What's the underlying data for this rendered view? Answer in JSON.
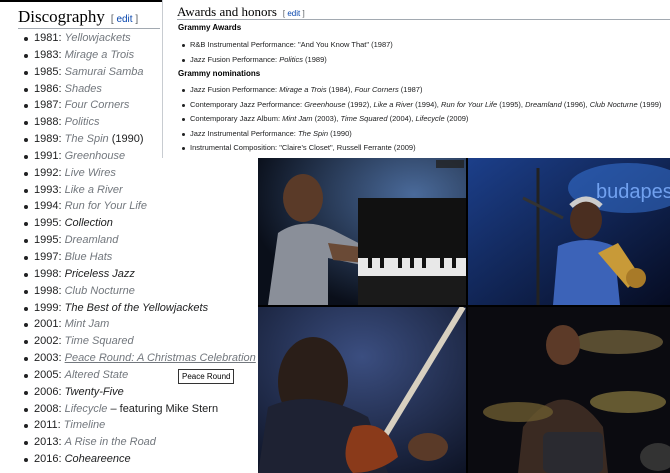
{
  "discography": {
    "title": "Discography",
    "edit_label": "edit",
    "albums": [
      {
        "year": "1981",
        "title": "Yellowjackets",
        "suffix": "",
        "style": "gray"
      },
      {
        "year": "1983",
        "title": "Mirage a Trois",
        "suffix": "",
        "style": "gray"
      },
      {
        "year": "1985",
        "title": "Samurai Samba",
        "suffix": "",
        "style": "gray"
      },
      {
        "year": "1986",
        "title": "Shades",
        "suffix": "",
        "style": "gray"
      },
      {
        "year": "1987",
        "title": "Four Corners",
        "suffix": "",
        "style": "gray"
      },
      {
        "year": "1988",
        "title": "Politics",
        "suffix": "",
        "style": "gray"
      },
      {
        "year": "1989",
        "title": "The Spin",
        "suffix": " (1990)",
        "style": "gray"
      },
      {
        "year": "1991",
        "title": "Greenhouse",
        "suffix": "",
        "style": "gray"
      },
      {
        "year": "1992",
        "title": "Live Wires",
        "suffix": "",
        "style": "gray"
      },
      {
        "year": "1993",
        "title": "Like a River",
        "suffix": "",
        "style": "gray"
      },
      {
        "year": "1994",
        "title": "Run for Your Life",
        "suffix": "",
        "style": "gray"
      },
      {
        "year": "1995",
        "title": "Collection",
        "suffix": "",
        "style": "dark"
      },
      {
        "year": "1995",
        "title": "Dreamland",
        "suffix": "",
        "style": "gray"
      },
      {
        "year": "1997",
        "title": "Blue Hats",
        "suffix": "",
        "style": "gray"
      },
      {
        "year": "1998",
        "title": "Priceless Jazz",
        "suffix": "",
        "style": "dark"
      },
      {
        "year": "1998",
        "title": "Club Nocturne",
        "suffix": "",
        "style": "gray"
      },
      {
        "year": "1999",
        "title": "The Best of the Yellowjackets",
        "suffix": "",
        "style": "dark"
      },
      {
        "year": "2001",
        "title": "Mint Jam",
        "suffix": "",
        "style": "gray"
      },
      {
        "year": "2002",
        "title": "Time Squared",
        "suffix": "",
        "style": "gray"
      },
      {
        "year": "2003",
        "title": "Peace Round: A Christmas Celebration",
        "suffix": "",
        "style": "link"
      },
      {
        "year": "2005",
        "title": "Altered State",
        "suffix": "",
        "style": "gray"
      },
      {
        "year": "2006",
        "title": "Twenty-Five",
        "suffix": "",
        "style": "dark"
      },
      {
        "year": "2008",
        "title": "Lifecycle",
        "suffix": " – featuring Mike Stern",
        "style": "gray"
      },
      {
        "year": "2011",
        "title": "Timeline",
        "suffix": "",
        "style": "gray"
      },
      {
        "year": "2013",
        "title": "A Rise in the Road",
        "suffix": "",
        "style": "gray"
      },
      {
        "year": "2016",
        "title": "Coheareence",
        "suffix": "",
        "style": "dark"
      }
    ],
    "tooltip": "Peace Round"
  },
  "awards": {
    "title": "Awards and honors",
    "edit_label": "edit",
    "grammy_awards_heading": "Grammy Awards",
    "grammy_awards": [
      [
        {
          "t": "R&B Instrumental Performance: \"And You Know That\" (1987)",
          "i": false
        }
      ],
      [
        {
          "t": "Jazz Fusion Performance: ",
          "i": false
        },
        {
          "t": "Politics",
          "i": true
        },
        {
          "t": " (1989)",
          "i": false
        }
      ]
    ],
    "nominations_heading": "Grammy nominations",
    "nominations": [
      [
        {
          "t": "Jazz Fusion Performance: ",
          "i": false
        },
        {
          "t": "Mirage a Trois",
          "i": true
        },
        {
          "t": " (1984), ",
          "i": false
        },
        {
          "t": "Four Corners",
          "i": true
        },
        {
          "t": " (1987)",
          "i": false
        }
      ],
      [
        {
          "t": "Contemporary Jazz Performance: ",
          "i": false
        },
        {
          "t": "Greenhouse",
          "i": true
        },
        {
          "t": " (1992), ",
          "i": false
        },
        {
          "t": "Like a River",
          "i": true
        },
        {
          "t": " (1994), ",
          "i": false
        },
        {
          "t": "Run for Your Life",
          "i": true
        },
        {
          "t": " (1995), ",
          "i": false
        },
        {
          "t": "Dreamland",
          "i": true
        },
        {
          "t": " (1996), ",
          "i": false
        },
        {
          "t": "Club Nocturne",
          "i": true
        },
        {
          "t": " (1999)",
          "i": false
        }
      ],
      [
        {
          "t": "Contemporary Jazz Album: ",
          "i": false
        },
        {
          "t": "Mint Jam",
          "i": true
        },
        {
          "t": " (2003), ",
          "i": false
        },
        {
          "t": "Time Squared",
          "i": true
        },
        {
          "t": " (2004), ",
          "i": false
        },
        {
          "t": "Lifecycle",
          "i": true
        },
        {
          "t": " (2009)",
          "i": false
        }
      ],
      [
        {
          "t": "Jazz Instrumental Performance: ",
          "i": false
        },
        {
          "t": "The Spin",
          "i": true
        },
        {
          "t": " (1990)",
          "i": false
        }
      ],
      [
        {
          "t": "Instrumental Composition: \"Claire's Closet\", Russell Ferrante (2009)",
          "i": false
        }
      ]
    ]
  },
  "photos": {
    "stage_sign_text": "budapest j"
  },
  "colors": {
    "gray_title": "#72777d",
    "link": "#0645ad"
  }
}
